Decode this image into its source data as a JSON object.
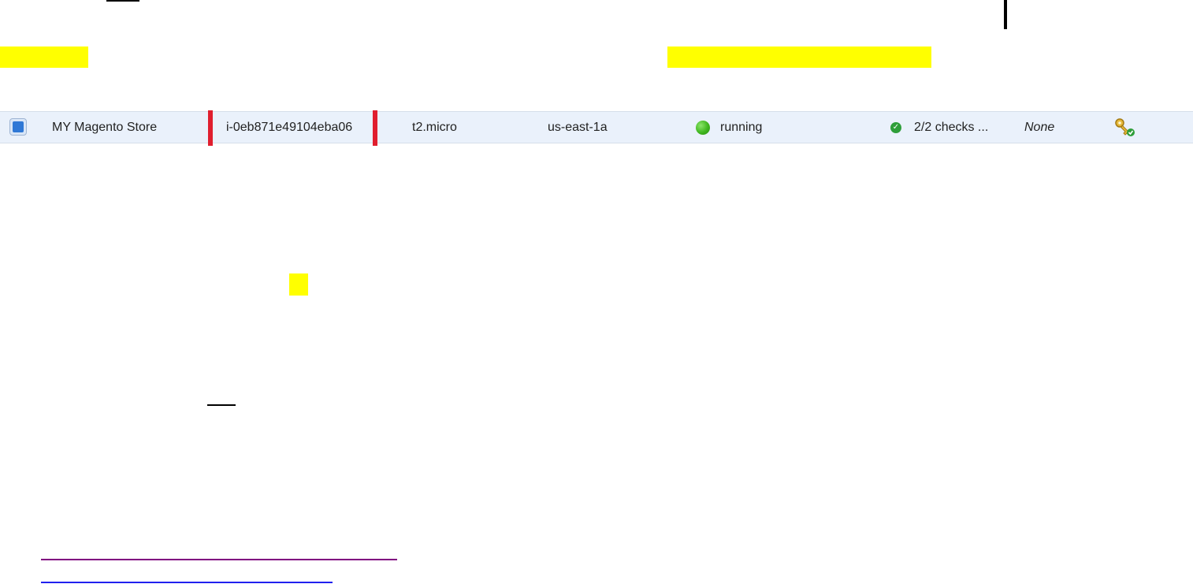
{
  "instance_row": {
    "name": "MY Magento Store",
    "instance_id": "i-0eb871e49104eba06",
    "instance_type": "t2.micro",
    "availability_zone": "us-east-1a",
    "state": "running",
    "status_checks": "2/2 checks ...",
    "alarm_status": "None",
    "colors": {
      "row_bg": "#eaf1fb",
      "highlight_bar": "#e01e2e",
      "running": "#3fb61f",
      "check_ok": "#2e9e3a"
    },
    "icons": [
      "checkbox-icon",
      "running-status-icon",
      "check-ok-icon",
      "key-icon"
    ]
  }
}
